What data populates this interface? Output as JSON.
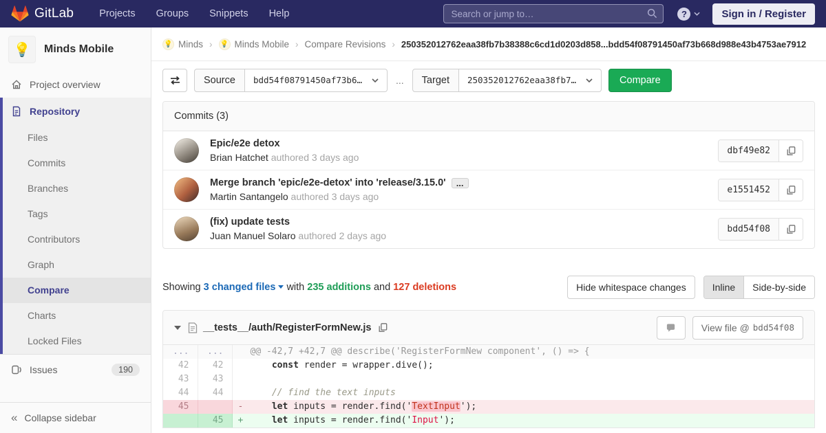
{
  "navbar": {
    "logo_text": "GitLab",
    "menu": [
      "Projects",
      "Groups",
      "Snippets",
      "Help"
    ],
    "search_placeholder": "Search or jump to…",
    "sign_in_label": "Sign in / Register"
  },
  "sidebar": {
    "project_avatar": "💡",
    "project_name": "Minds Mobile",
    "overview_label": "Project overview",
    "repository_label": "Repository",
    "repo_items": [
      "Files",
      "Commits",
      "Branches",
      "Tags",
      "Contributors",
      "Graph",
      "Compare",
      "Charts",
      "Locked Files"
    ],
    "active_item": "Compare",
    "issues_label": "Issues",
    "issues_count": "190",
    "collapse_label": "Collapse sidebar"
  },
  "breadcrumb": {
    "items": [
      {
        "label": "Minds",
        "avatar": "💡"
      },
      {
        "label": "Minds Mobile",
        "avatar": "💡"
      },
      {
        "label": "Compare Revisions",
        "avatar": ""
      }
    ],
    "separator": "›",
    "current": "250352012762eaa38fb7b38388c6cd1d0203d858...bdd54f08791450af73b668d988e43b4753ae7912"
  },
  "compare_form": {
    "source_label": "Source",
    "source_value": "bdd54f08791450af73b6…",
    "separator": "...",
    "target_label": "Target",
    "target_value": "250352012762eaa38fb7…",
    "compare_button": "Compare"
  },
  "commits": {
    "header": "Commits (3)",
    "items": [
      {
        "title": "Epic/e2e detox",
        "author": "Brian Hatchet",
        "meta": " authored 3 days ago",
        "sha": "dbf49e82",
        "expander": false
      },
      {
        "title": "Merge branch 'epic/e2e-detox' into 'release/3.15.0'",
        "author": "Martin Santangelo",
        "meta": " authored 3 days ago",
        "sha": "e1551452",
        "expander": true
      },
      {
        "title": "(fix) update tests",
        "author": "Juan Manuel Solaro",
        "meta": " authored 2 days ago",
        "sha": "bdd54f08",
        "expander": false
      }
    ]
  },
  "summary": {
    "showing": "Showing",
    "files_link": "3 changed files",
    "with_text": "with",
    "additions": "235 additions",
    "and_text": "and",
    "deletions": "127 deletions",
    "hide_whitespace": "Hide whitespace changes",
    "inline": "Inline",
    "side_by_side": "Side-by-side"
  },
  "diff": {
    "file_path": "__tests__/auth/RegisterFormNew.js",
    "view_file_label": "View file @",
    "view_file_sha": "bdd54f08",
    "lines": [
      {
        "type": "match",
        "old": "...",
        "new": "...",
        "sign": "",
        "tokens": [
          {
            "c": "match",
            "v": "@@ -42,7 +42,7 @@ describe('RegisterFormNew component', () => {"
          }
        ]
      },
      {
        "type": "context",
        "old": "42",
        "new": "42",
        "sign": "",
        "tokens": [
          {
            "c": "",
            "v": "    "
          },
          {
            "c": "kw",
            "v": "const"
          },
          {
            "c": "",
            "v": " render = wrapper.dive();"
          }
        ]
      },
      {
        "type": "context",
        "old": "43",
        "new": "43",
        "sign": "",
        "tokens": []
      },
      {
        "type": "context",
        "old": "44",
        "new": "44",
        "sign": "",
        "tokens": [
          {
            "c": "",
            "v": "    "
          },
          {
            "c": "comment",
            "v": "// find the text inputs"
          }
        ]
      },
      {
        "type": "removed",
        "old": "45",
        "new": "",
        "sign": "-",
        "tokens": [
          {
            "c": "",
            "v": "    "
          },
          {
            "c": "kw",
            "v": "let"
          },
          {
            "c": "",
            "v": " inputs = render.find('"
          },
          {
            "c": "strhl",
            "v": "TextInput"
          },
          {
            "c": "",
            "v": "');"
          }
        ]
      },
      {
        "type": "added",
        "old": "",
        "new": "45",
        "sign": "+",
        "tokens": [
          {
            "c": "",
            "v": "    "
          },
          {
            "c": "kw",
            "v": "let"
          },
          {
            "c": "",
            "v": " inputs = render.find('"
          },
          {
            "c": "str",
            "v": "Input"
          },
          {
            "c": "",
            "v": "');"
          }
        ]
      }
    ]
  },
  "colors": {
    "navbar_bg": "#292961",
    "accent_green": "#1aaa55",
    "link_blue": "#1b69b6",
    "danger_red": "#db3b21",
    "indigo": "#41418f",
    "added_bg": "#ecfdf0",
    "removed_bg": "#fbe9eb",
    "removed_word_bg": "#fac5cd"
  }
}
